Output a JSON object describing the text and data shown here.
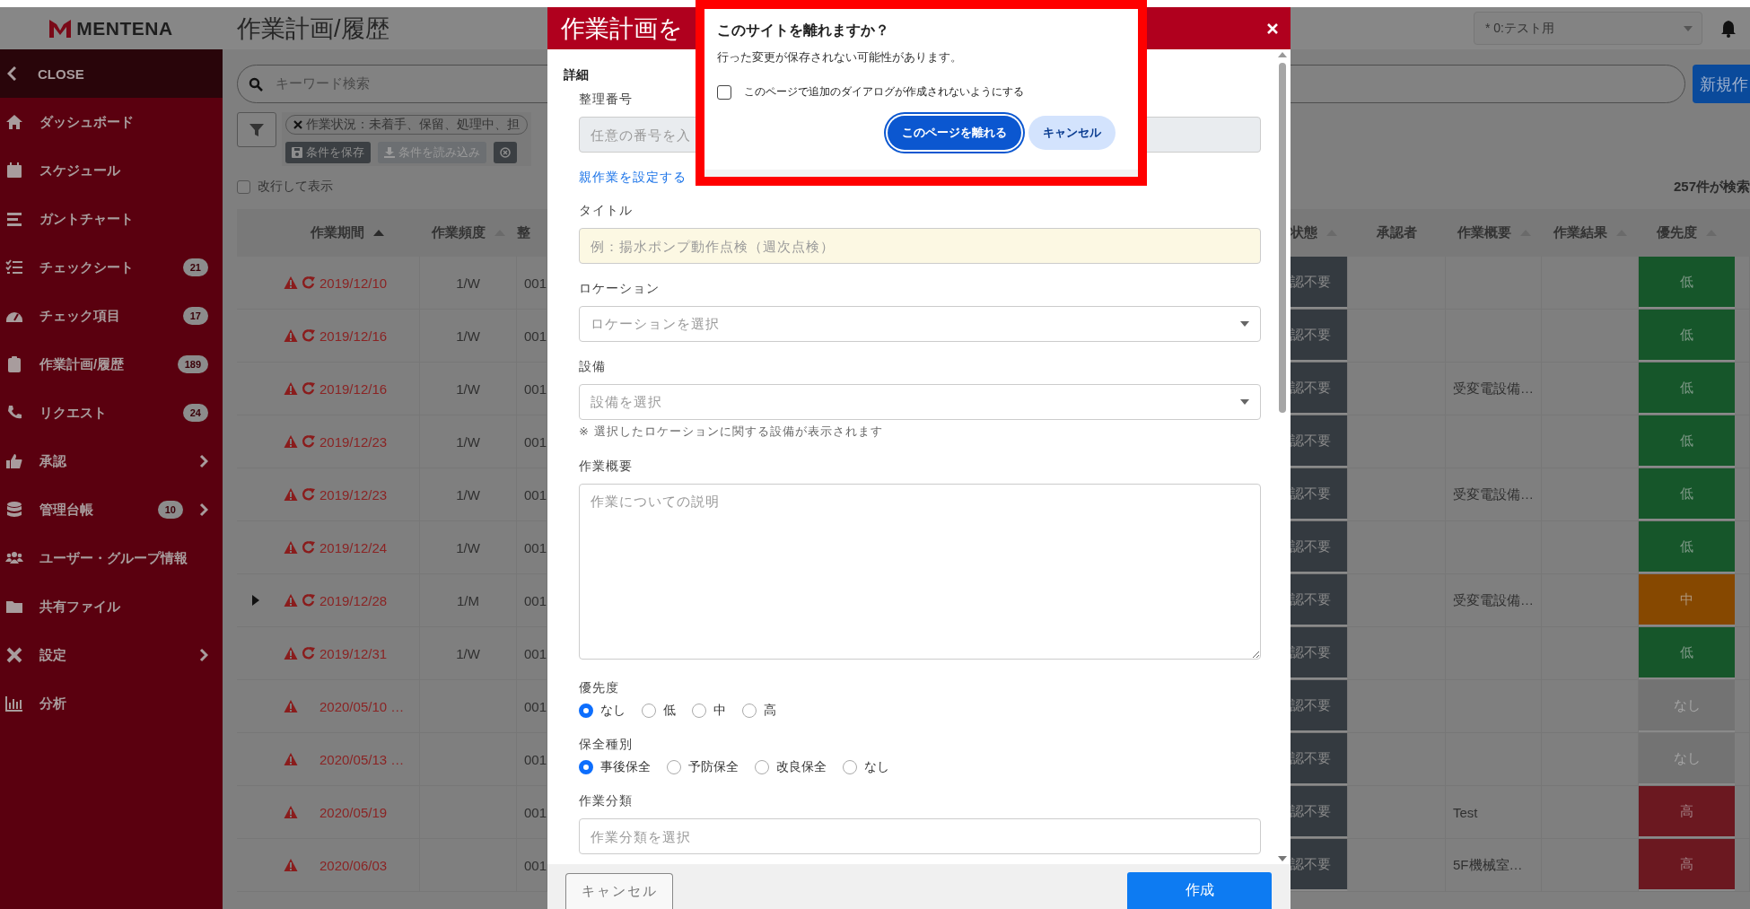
{
  "sidebar": {
    "logo": "MENTENA",
    "close": "CLOSE",
    "items": [
      {
        "label": "ダッシュボード",
        "submenu": false
      },
      {
        "label": "スケジュール",
        "submenu": false
      },
      {
        "label": "ガントチャート",
        "submenu": false
      },
      {
        "label": "チェックシート",
        "badge": "21",
        "submenu": false
      },
      {
        "label": "チェック項目",
        "badge": "17",
        "submenu": false
      },
      {
        "label": "作業計画/履歴",
        "badge": "189",
        "submenu": false
      },
      {
        "label": "リクエスト",
        "badge": "24",
        "submenu": false
      },
      {
        "label": "承認",
        "submenu": true
      },
      {
        "label": "管理台帳",
        "badge": "10",
        "submenu": true
      },
      {
        "label": "ユーザー・グループ情報",
        "submenu": false
      },
      {
        "label": "共有ファイル",
        "submenu": false
      },
      {
        "label": "設定",
        "submenu": true
      },
      {
        "label": "分析",
        "submenu": false
      }
    ]
  },
  "header": {
    "title": "作業計画/履歴",
    "tenant_select": {
      "value": "* 0:テスト用"
    }
  },
  "search": {
    "placeholder": "キーワード検索"
  },
  "new_button": "新規作",
  "filter": {
    "chip": "作業状況：未着手、保留、処理中、担",
    "actions": [
      "条件を保存",
      "条件を読み込み"
    ]
  },
  "wrap_toggle": {
    "label": "改行して表示",
    "checked": false
  },
  "result_count": "257件が検索",
  "table": {
    "left_columns": [
      {
        "label": "作業期間",
        "sortable": true,
        "sorted": true
      },
      {
        "label": "作業頻度",
        "sortable": true,
        "sorted": false
      },
      {
        "label": "整",
        "sortable": false
      }
    ],
    "right_columns": [
      {
        "label": "状態",
        "sortable": true,
        "sorted": false
      },
      {
        "label": "承認者",
        "sortable": false
      },
      {
        "label": "作業概要",
        "sortable": true,
        "sorted": false
      },
      {
        "label": "作業結果",
        "sortable": true,
        "sorted": false
      },
      {
        "label": "優先度",
        "sortable": true,
        "sorted": false
      }
    ],
    "rows": [
      {
        "expandable": false,
        "overdue": true,
        "recurring": true,
        "date": "2019/12/10",
        "frequency": "1/W",
        "column_3": "001",
        "status": "認不要",
        "priority": "低",
        "color": "#16562a"
      },
      {
        "expandable": false,
        "overdue": true,
        "recurring": true,
        "date": "2019/12/16",
        "frequency": "1/W",
        "column_3": "001",
        "status": "認不要",
        "priority": "低",
        "color": "#16562a"
      },
      {
        "expandable": false,
        "overdue": true,
        "recurring": true,
        "date": "2019/12/16",
        "frequency": "1/W",
        "column_3": "001",
        "status": "認不要",
        "summary": "受変電設備…",
        "priority": "低",
        "color": "#16562a"
      },
      {
        "expandable": false,
        "overdue": true,
        "recurring": true,
        "date": "2019/12/23",
        "frequency": "1/W",
        "column_3": "001",
        "status": "認不要",
        "priority": "低",
        "color": "#16562a"
      },
      {
        "expandable": false,
        "overdue": true,
        "recurring": true,
        "date": "2019/12/23",
        "frequency": "1/W",
        "column_3": "001",
        "status": "認不要",
        "summary": "受変電設備…",
        "priority": "低",
        "color": "#16562a"
      },
      {
        "expandable": false,
        "overdue": true,
        "recurring": true,
        "date": "2019/12/24",
        "frequency": "1/W",
        "column_3": "001",
        "status": "認不要",
        "priority": "低",
        "color": "#16562a"
      },
      {
        "expandable": true,
        "overdue": true,
        "recurring": true,
        "date": "2019/12/28",
        "frequency": "1/M",
        "column_3": "001",
        "status": "認不要",
        "summary": "受変電設備…",
        "priority": "中",
        "color": "#864800"
      },
      {
        "expandable": false,
        "overdue": true,
        "recurring": true,
        "date": "2019/12/31",
        "frequency": "1/W",
        "column_3": "001",
        "status": "認不要",
        "priority": "低",
        "color": "#16562a"
      },
      {
        "expandable": false,
        "overdue": true,
        "recurring": false,
        "date": "2020/05/10 …",
        "column_3": "001",
        "status": "認不要",
        "priority": "なし",
        "color": "#737373"
      },
      {
        "expandable": false,
        "overdue": true,
        "recurring": false,
        "date": "2020/05/13 …",
        "column_3": "001",
        "status": "認不要",
        "priority": "なし",
        "color": "#737373"
      },
      {
        "expandable": false,
        "overdue": true,
        "recurring": false,
        "date": "2020/05/19",
        "column_3": "001",
        "status": "認不要",
        "summary": "Test",
        "priority": "高",
        "color": "#6b1820"
      },
      {
        "expandable": false,
        "overdue": true,
        "recurring": false,
        "date": "2020/06/03",
        "column_3": "001",
        "status": "認不要",
        "summary": "5F機械室…",
        "priority": "高",
        "color": "#6b1820"
      }
    ]
  },
  "modal": {
    "title": "作業計画を",
    "section": "詳細",
    "fields": [
      {
        "kind": "input",
        "label": "整理番号",
        "placeholder": "任意の番号を入",
        "disabled": true
      },
      {
        "kind": "link",
        "text": "親作業を設定する"
      },
      {
        "kind": "input",
        "label": "タイトル",
        "placeholder": "例：揚水ポンプ動作点検（週次点検）",
        "highlighted": true
      },
      {
        "kind": "select",
        "label": "ロケーション",
        "placeholder": "ロケーションを選択"
      },
      {
        "kind": "select",
        "label": "設備",
        "placeholder": "設備を選択",
        "note": "※ 選択したロケーションに関する設備が表示されます"
      },
      {
        "kind": "textarea",
        "label": "作業概要",
        "placeholder": "作業についての説明"
      },
      {
        "kind": "radio",
        "label": "優先度",
        "options": [
          {
            "label": "なし",
            "selected": true
          },
          {
            "label": "低",
            "selected": false
          },
          {
            "label": "中",
            "selected": false
          },
          {
            "label": "高",
            "selected": false
          }
        ]
      },
      {
        "kind": "radio",
        "label": "保全種別",
        "options": [
          {
            "label": "事後保全",
            "selected": true
          },
          {
            "label": "予防保全",
            "selected": false
          },
          {
            "label": "改良保全",
            "selected": false
          },
          {
            "label": "なし",
            "selected": false
          }
        ]
      },
      {
        "kind": "input",
        "label": "作業分類",
        "placeholder": "作業分類を選択"
      }
    ],
    "footer": {
      "cancel": "キャンセル",
      "submit": "作成"
    }
  },
  "dialog": {
    "title": "このサイトを離れますか？",
    "message": "行った変更が保存されない可能性があります。",
    "checkbox": {
      "label": "このページで追加のダイアログが作成されないようにする",
      "checked": false
    },
    "leave": "このページを離れる",
    "cancel": "キャンセル"
  }
}
